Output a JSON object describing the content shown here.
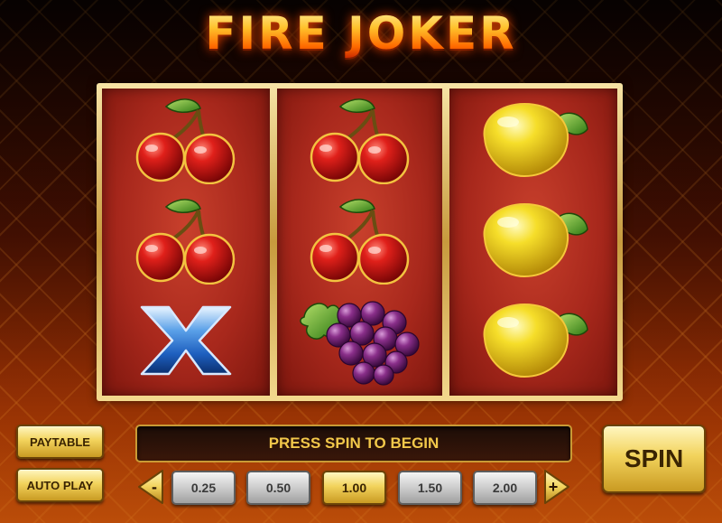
{
  "game": {
    "title": "FIRE JOKER"
  },
  "reels": [
    {
      "symbols": [
        "cherry-icon",
        "cherry-icon",
        "x-icon"
      ]
    },
    {
      "symbols": [
        "cherry-icon",
        "cherry-icon",
        "grapes-icon"
      ]
    },
    {
      "symbols": [
        "lemon-icon",
        "lemon-icon",
        "lemon-icon"
      ]
    }
  ],
  "controls": {
    "paytable_label": "PAYTABLE",
    "autoplay_label": "AUTO PLAY",
    "spin_label": "SPIN",
    "minus_label": "-",
    "plus_label": "+",
    "message": "PRESS SPIN TO BEGIN"
  },
  "bets": {
    "options": [
      "0.25",
      "0.50",
      "1.00",
      "1.50",
      "2.00"
    ],
    "selected": "1.00"
  },
  "colors": {
    "gold": "#f2d35c",
    "reel_red": "#a8281c",
    "message_text": "#f2c84a"
  }
}
